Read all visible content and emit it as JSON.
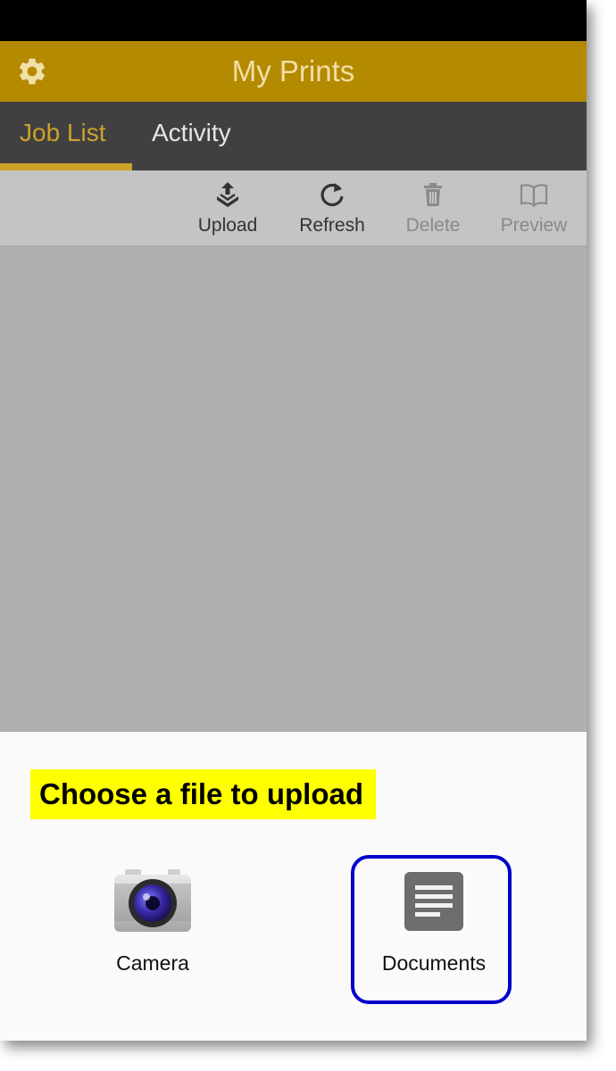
{
  "colors": {
    "header": "#b48a00",
    "tab_bar": "#404040",
    "tab_active": "#cda22a",
    "highlight": "#ffff00",
    "focus_ring": "#0000cc"
  },
  "header": {
    "title": "My Prints",
    "settings_icon": "gear-icon"
  },
  "tabs": [
    {
      "label": "Job List",
      "active": true
    },
    {
      "label": "Activity",
      "active": false
    }
  ],
  "toolbar": {
    "upload": {
      "label": "Upload",
      "icon": "upload-icon",
      "enabled": true
    },
    "refresh": {
      "label": "Refresh",
      "icon": "refresh-icon",
      "enabled": true
    },
    "delete": {
      "label": "Delete",
      "icon": "trash-icon",
      "enabled": false
    },
    "preview": {
      "label": "Preview",
      "icon": "book-icon",
      "enabled": false
    }
  },
  "sheet": {
    "title": "Choose a file to upload",
    "options": [
      {
        "label": "Camera",
        "icon": "camera-icon"
      },
      {
        "label": "Documents",
        "icon": "document-icon",
        "highlighted": true
      }
    ]
  }
}
